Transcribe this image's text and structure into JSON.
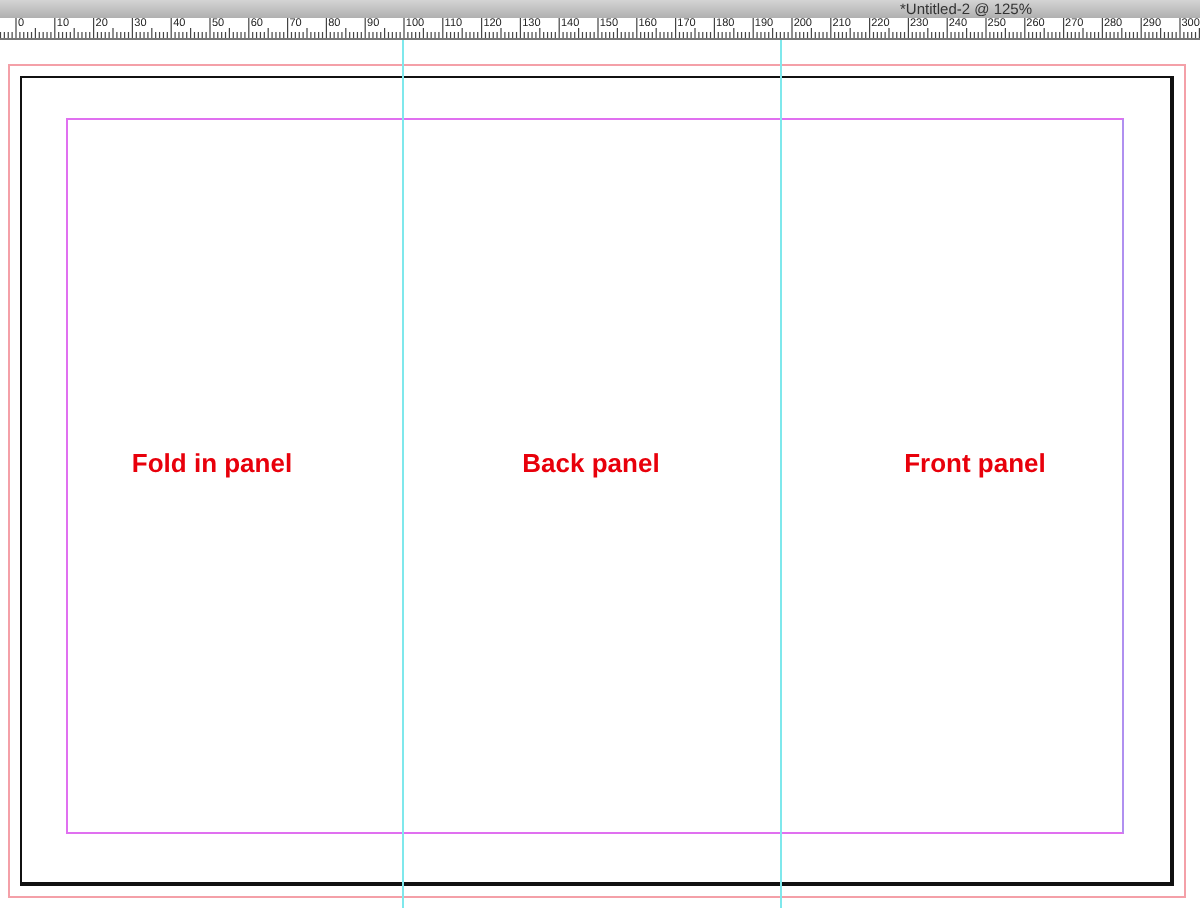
{
  "window": {
    "title": "*Untitled-2 @ 125%"
  },
  "ruler": {
    "labels": [
      "0",
      "10",
      "20",
      "30",
      "40",
      "50",
      "60",
      "70",
      "80",
      "90",
      "100",
      "110",
      "120",
      "130",
      "140",
      "150",
      "160",
      "170",
      "180",
      "190",
      "200",
      "210",
      "220",
      "230",
      "240",
      "250",
      "260",
      "270",
      "280",
      "290",
      "300"
    ]
  },
  "panels": [
    {
      "label": "Fold in panel"
    },
    {
      "label": "Back panel"
    },
    {
      "label": "Front panel"
    }
  ]
}
